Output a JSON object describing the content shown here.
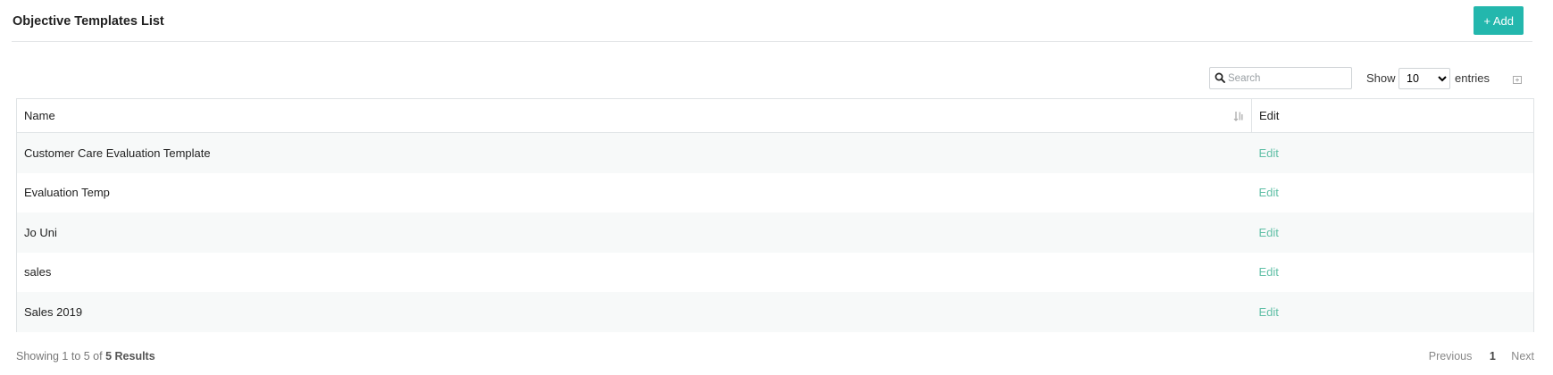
{
  "header": {
    "title": "Objective Templates List",
    "add_label": "+ Add"
  },
  "toolbar": {
    "search_placeholder": "Search",
    "search_value": "",
    "show_label": "Show",
    "entries_selected": "10",
    "entries_label": "entries"
  },
  "table": {
    "headers": {
      "name": "Name",
      "edit": "Edit"
    },
    "rows": [
      {
        "name": "Customer Care Evaluation Template",
        "edit": "Edit"
      },
      {
        "name": "Evaluation Temp",
        "edit": "Edit"
      },
      {
        "name": "Jo Uni",
        "edit": "Edit"
      },
      {
        "name": "sales",
        "edit": "Edit"
      },
      {
        "name": "Sales 2019",
        "edit": "Edit"
      }
    ]
  },
  "footer": {
    "info_prefix": "Showing 1 to 5 of",
    "info_total": "5 Results",
    "previous_label": "Previous",
    "current_page": "1",
    "next_label": "Next"
  },
  "icons": {
    "search": "search-icon",
    "sort": "sort-icon",
    "export": "export-icon",
    "dropdown": "chevron-down-icon"
  },
  "colors": {
    "accent": "#23b7ad",
    "link": "#5fbfa6",
    "stripe": "#f7f9f9"
  }
}
